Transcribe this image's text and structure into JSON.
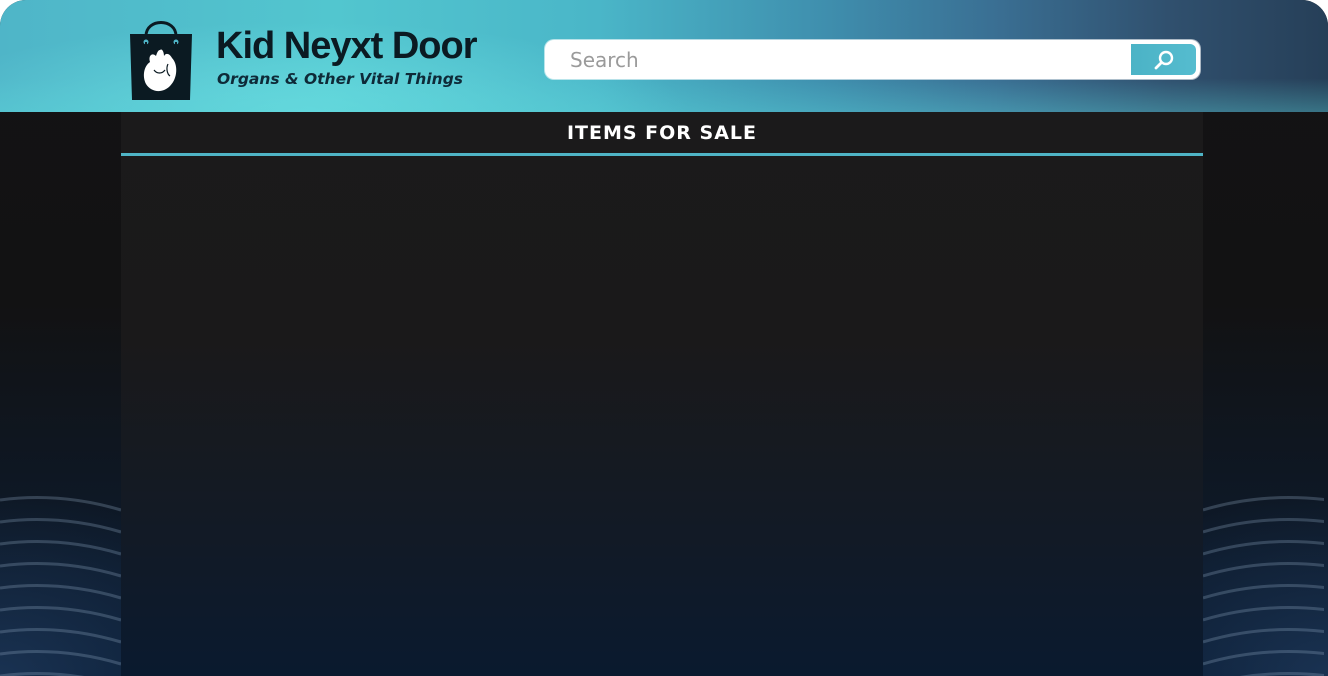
{
  "app": {
    "brand_name": "Kid Neyxt Door",
    "tagline": "Organs & Other Vital Things",
    "logo_icon": "shopping-bag-heart-icon"
  },
  "search": {
    "placeholder": "Search",
    "value": "",
    "button_icon": "search-icon"
  },
  "main": {
    "section_title": "ITEMS FOR SALE",
    "items": []
  },
  "colors": {
    "accent": "#4fb4c6",
    "header_start": "#52c6cf",
    "header_end": "#263f58",
    "panel": "#1b1a1b",
    "background": "#121213"
  }
}
